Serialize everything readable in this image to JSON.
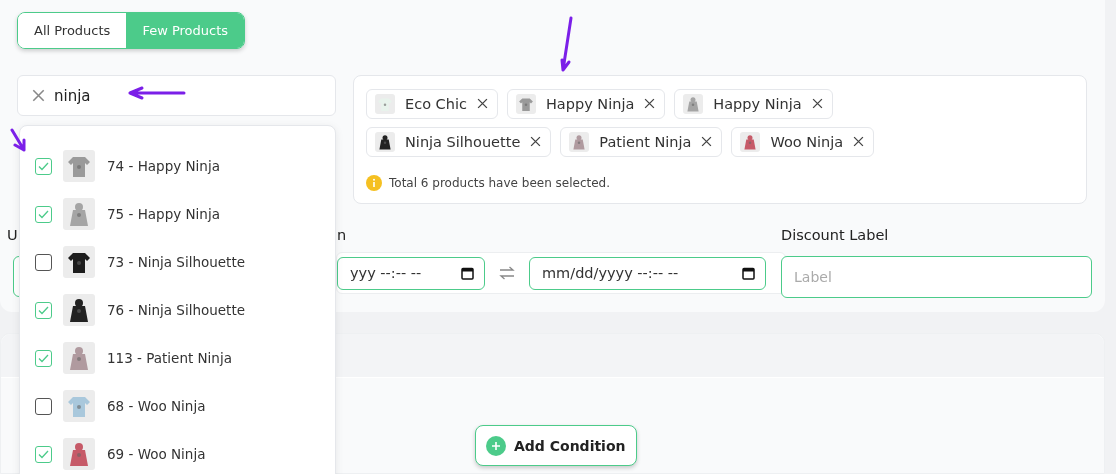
{
  "tabs": [
    {
      "label": "All Products",
      "selected": false
    },
    {
      "label": "Few Products",
      "selected": true
    }
  ],
  "search": {
    "value": "ninja"
  },
  "results": [
    {
      "label": "74 - Happy Ninja",
      "checked": true
    },
    {
      "label": "75 - Happy Ninja",
      "checked": true
    },
    {
      "label": "73 - Ninja Silhouette",
      "checked": false
    },
    {
      "label": "76 - Ninja Silhouette",
      "checked": true
    },
    {
      "label": "113 - Patient Ninja",
      "checked": true
    },
    {
      "label": "68 - Woo Ninja",
      "checked": false
    },
    {
      "label": "69 - Woo Ninja",
      "checked": true
    }
  ],
  "selected_chips": [
    {
      "label": "Eco Chic"
    },
    {
      "label": "Happy Ninja"
    },
    {
      "label": "Happy Ninja"
    },
    {
      "label": "Ninja Silhouette"
    },
    {
      "label": "Patient Ninja"
    },
    {
      "label": "Woo Ninja"
    }
  ],
  "selection_note": "Total 6 products have been selected.",
  "schedule": {
    "label_1": "U",
    "label_2": "n",
    "start_fragment": "yyy --:-- --",
    "end_placeholder": "mm/dd/yyyy --:-- --"
  },
  "discount_label": {
    "label": "Discount Label",
    "placeholder": "Label"
  },
  "add_condition": "Add Condition"
}
